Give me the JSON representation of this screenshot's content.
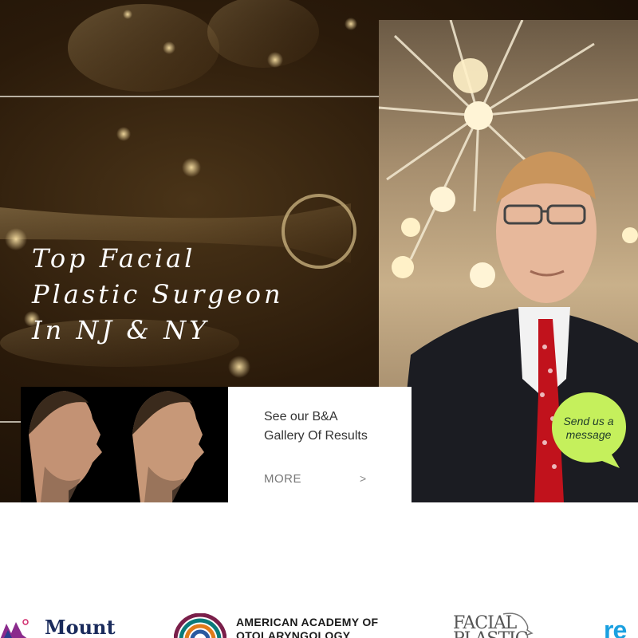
{
  "hero": {
    "headline": [
      "Top Facial",
      "Plastic Surgeon",
      "In NJ & NY"
    ]
  },
  "gallery": {
    "title": [
      "See our B&A",
      "Gallery Of Results"
    ],
    "more_label": "MORE",
    "arrow": ">"
  },
  "chat": {
    "label": [
      "Send us a",
      "message"
    ],
    "color": "#c5f05c"
  },
  "logos": {
    "mount": "Mount",
    "aao": [
      "AMERICAN ACADEMY OF",
      "OTOLARYNGOLOGY"
    ],
    "facial_plastic": [
      "FACIAL",
      "PLASTIC"
    ],
    "re": "re"
  },
  "icons": [
    "mount-sinai-logo-icon",
    "aao-logo-icon",
    "facial-plastic-logo-icon",
    "chat-bubble-icon"
  ]
}
